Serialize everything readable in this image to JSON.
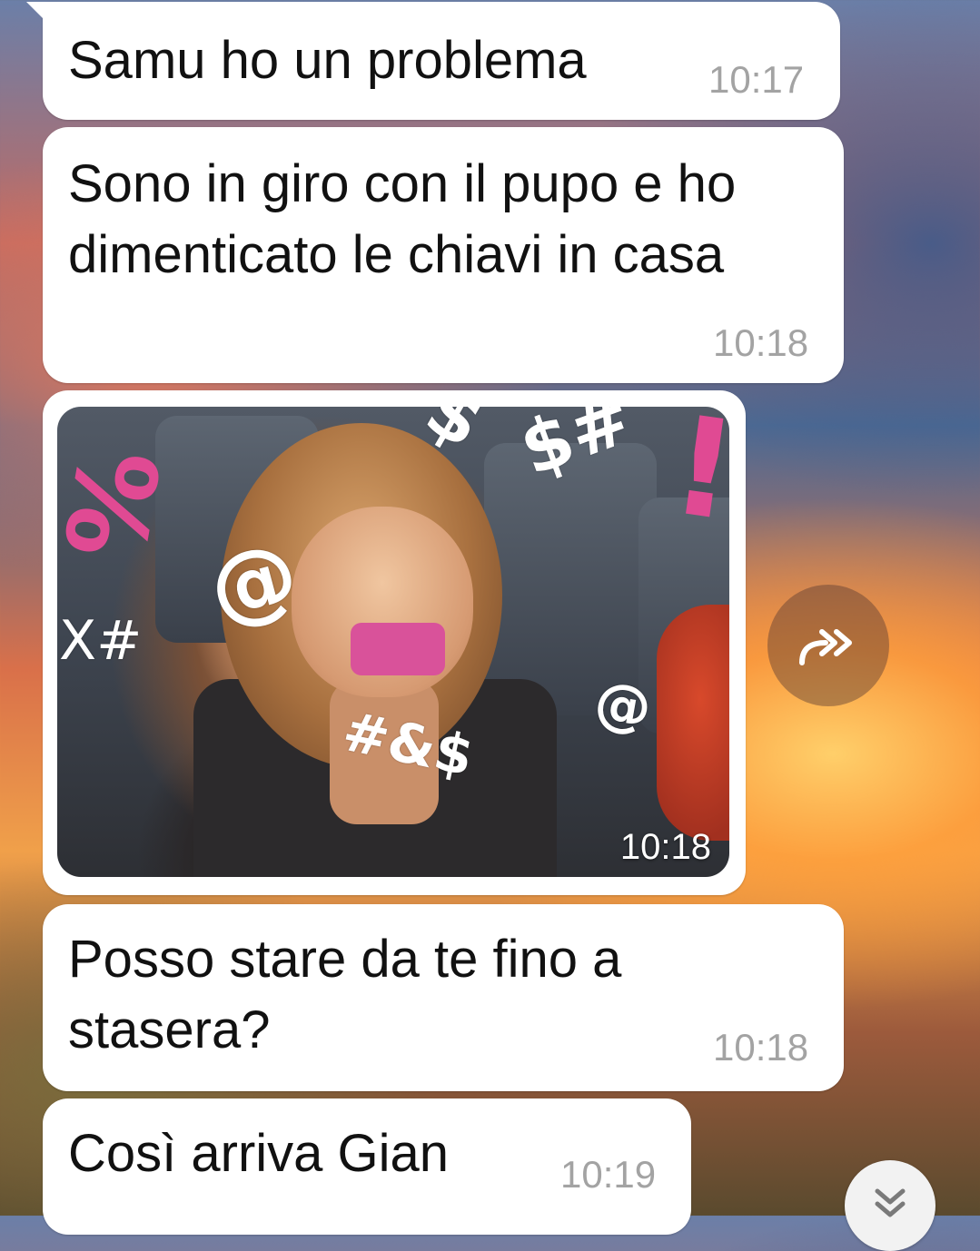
{
  "messages": [
    {
      "text": "Samu ho un problema",
      "time": "10:17"
    },
    {
      "text": "Sono in giro con il pupo e ho dimenticato le chiavi in casa",
      "time": "10:18"
    },
    {
      "type": "gif",
      "time": "10:18",
      "overlay_symbols": [
        "%",
        "@",
        "X#",
        "#&$",
        "@",
        "$",
        "$#",
        "!"
      ]
    },
    {
      "text": "Posso stare da te fino a stasera?",
      "time": "10:18"
    },
    {
      "text": "Così arriva Gian",
      "time": "10:19"
    }
  ],
  "icons": {
    "forward": "forward-icon",
    "scroll_down": "chevrons-down-icon"
  },
  "colors": {
    "bubble": "#ffffff",
    "time": "#a3a3a3",
    "censor": "#d9529a"
  }
}
